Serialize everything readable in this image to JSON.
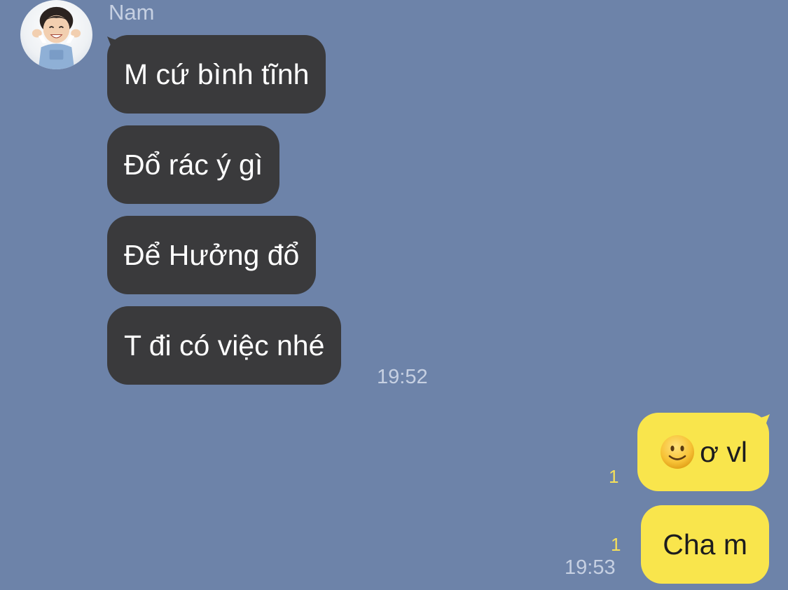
{
  "conversation": {
    "sender": {
      "name": "Nam",
      "avatar": "child-portrait-avatar"
    },
    "incoming_messages": [
      {
        "text": "M cứ bình tĩnh"
      },
      {
        "text": "Đổ rác ý gì"
      },
      {
        "text": "Để Hưởng đổ"
      },
      {
        "text": "T đi có việc nhé"
      }
    ],
    "incoming_time": "19:52",
    "outgoing_messages": [
      {
        "emoji": "slightly-smiling-face-icon",
        "text": "ơ vl",
        "unread_count": "1"
      },
      {
        "text": "Cha m",
        "unread_count": "1"
      }
    ],
    "outgoing_time": "19:53"
  },
  "colors": {
    "background": "#6d83a9",
    "incoming_bubble": "#3a3a3c",
    "outgoing_bubble": "#f9e54c",
    "unread_count": "#f5e05a",
    "meta_text": "#c6d0e2"
  }
}
